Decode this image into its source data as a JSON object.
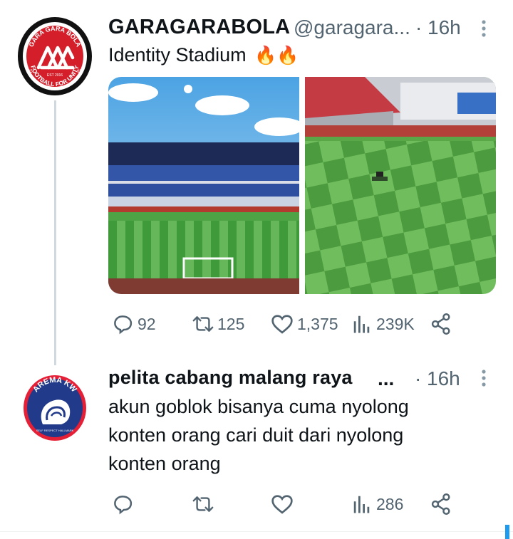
{
  "tweet": {
    "author_name": "GARAGARABOLA",
    "handle": "@garagara...",
    "dot": "·",
    "time": "16h",
    "text": "Identity Stadium",
    "emoji": "🔥🔥",
    "avatar_text_top": "GARA GARA BOLA",
    "avatar_text_bottom": "FOOTBALL FOR UNITY",
    "avatar_est": "EST 2016",
    "avatar_side_left": "65",
    "avatar_side_right": "65",
    "replies": "92",
    "retweets": "125",
    "likes": "1,375",
    "views": "239K",
    "images": [
      {
        "name": "stadium-stands-photo",
        "icon": "stadium-photo"
      },
      {
        "name": "pitch-grass-photo",
        "icon": "grass-mower-photo"
      }
    ]
  },
  "reply": {
    "author_name": "pelita cabang malang raya",
    "ellipsis": "...",
    "dot": "·",
    "time": "16h",
    "lines": [
      "akun goblok bisanya cuma nyolong",
      "konten orang cari duit dari nyolong",
      "konten orang"
    ],
    "avatar_text": "AREMA KW",
    "avatar_small": "SELF RESPECT HALLMARK",
    "replies": "",
    "retweets": "",
    "likes": "",
    "views": "286"
  },
  "colors": {
    "text": "#0f1419",
    "secondary": "#536471",
    "accent": "#1d9bf0",
    "avatar1_red": "#d41f2b",
    "avatar2_navy": "#223a8a"
  }
}
